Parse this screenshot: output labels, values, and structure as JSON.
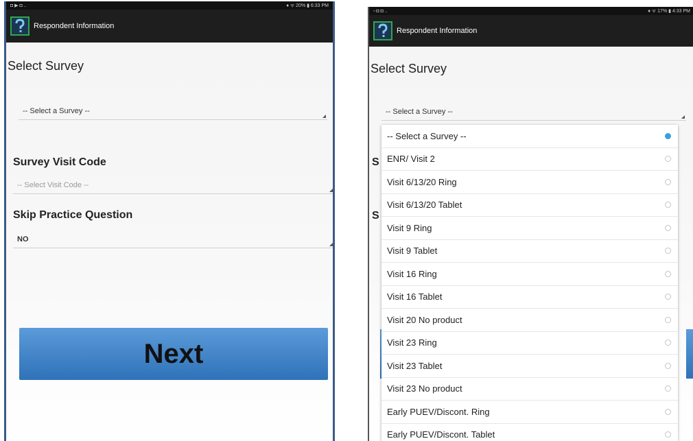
{
  "left": {
    "status_left": "◘ ▶ ◘ ..",
    "status_right": "♦ ᯤ 20% ▮ 6:33 PM",
    "app_title": "Respondent Information",
    "select_survey_title": "Select Survey",
    "survey_spinner_value": "-- Select a Survey --",
    "visit_code_label": "Survey Visit Code",
    "visit_code_placeholder": "-- Select Visit Code --",
    "skip_label": "Skip Practice Question",
    "skip_value": "NO",
    "next_label": "Next"
  },
  "right": {
    "status_left": "▫ ◘ ◘ ..",
    "status_right": "♦ ᯤ 17% ▮ 4:33 PM",
    "app_title": "Respondent Information",
    "select_survey_title": "Select Survey",
    "survey_spinner_value": "-- Select a Survey --",
    "dropdown_options": [
      {
        "label": "-- Select a Survey --",
        "selected": true
      },
      {
        "label": "ENR/ Visit 2",
        "selected": false
      },
      {
        "label": "Visit 6/13/20 Ring",
        "selected": false
      },
      {
        "label": "Visit 6/13/20 Tablet",
        "selected": false
      },
      {
        "label": "Visit 9 Ring",
        "selected": false
      },
      {
        "label": "Visit 9 Tablet",
        "selected": false
      },
      {
        "label": "Visit 16 Ring",
        "selected": false
      },
      {
        "label": "Visit 16 Tablet",
        "selected": false
      },
      {
        "label": "Visit 20 No product",
        "selected": false
      },
      {
        "label": "Visit 23 Ring",
        "selected": false
      },
      {
        "label": "Visit 23 Tablet",
        "selected": false
      },
      {
        "label": "Visit 23 No product",
        "selected": false
      },
      {
        "label": "Early PUEV/Discont. Ring",
        "selected": false
      },
      {
        "label": "Early PUEV/Discont. Tablet",
        "selected": false
      }
    ]
  },
  "colors": {
    "accent_blue": "#3a9fe0",
    "button_blue": "#4a8ccd",
    "logo_green": "#2ea84e"
  },
  "icons": {
    "app_logo": "question-mark-logo-icon",
    "spinner_arrow": "spinner-corner-icon",
    "radio": "radio-icon"
  }
}
